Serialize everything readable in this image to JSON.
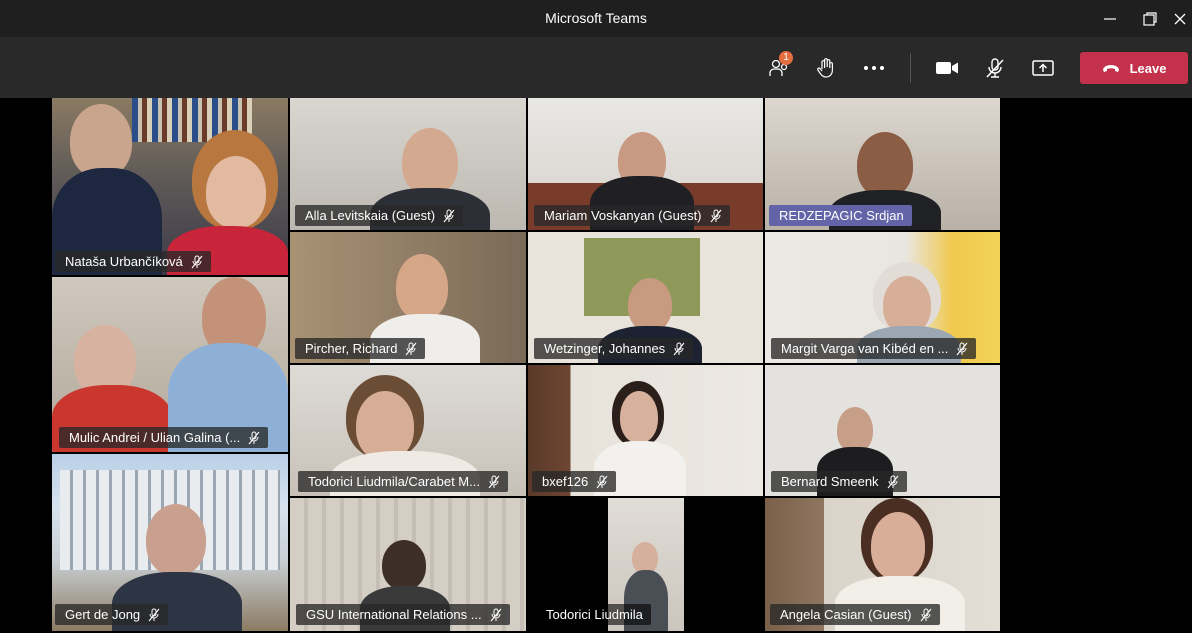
{
  "window": {
    "title": "Microsoft Teams"
  },
  "toolbar": {
    "participants_badge": "1",
    "leave_label": "Leave"
  },
  "colors": {
    "leave": "#c4314b",
    "badge": "#e36d3e",
    "presenter_highlight": "#6264a7"
  },
  "tiles": [
    {
      "name": "Nataša Urbančíková"
    },
    {
      "name": "Alla Levitskaia (Guest)"
    },
    {
      "name": "Mariam Voskanyan (Guest)"
    },
    {
      "name": "REDZEPAGIC Srdjan"
    },
    {
      "name": "Pircher, Richard"
    },
    {
      "name": "Wetzinger, Johannes"
    },
    {
      "name": "Margit Varga van Kibéd en ..."
    },
    {
      "name": "Mulic Andrei / Ulian Galina (..."
    },
    {
      "name": "Todorici Liudmila/Carabet M..."
    },
    {
      "name": "bxef126"
    },
    {
      "name": "Bernard Smeenk"
    },
    {
      "name": "Gert de Jong"
    },
    {
      "name": "GSU International Relations ..."
    },
    {
      "name": "Todorici Liudmila"
    },
    {
      "name": "Angela Casian (Guest)"
    }
  ]
}
